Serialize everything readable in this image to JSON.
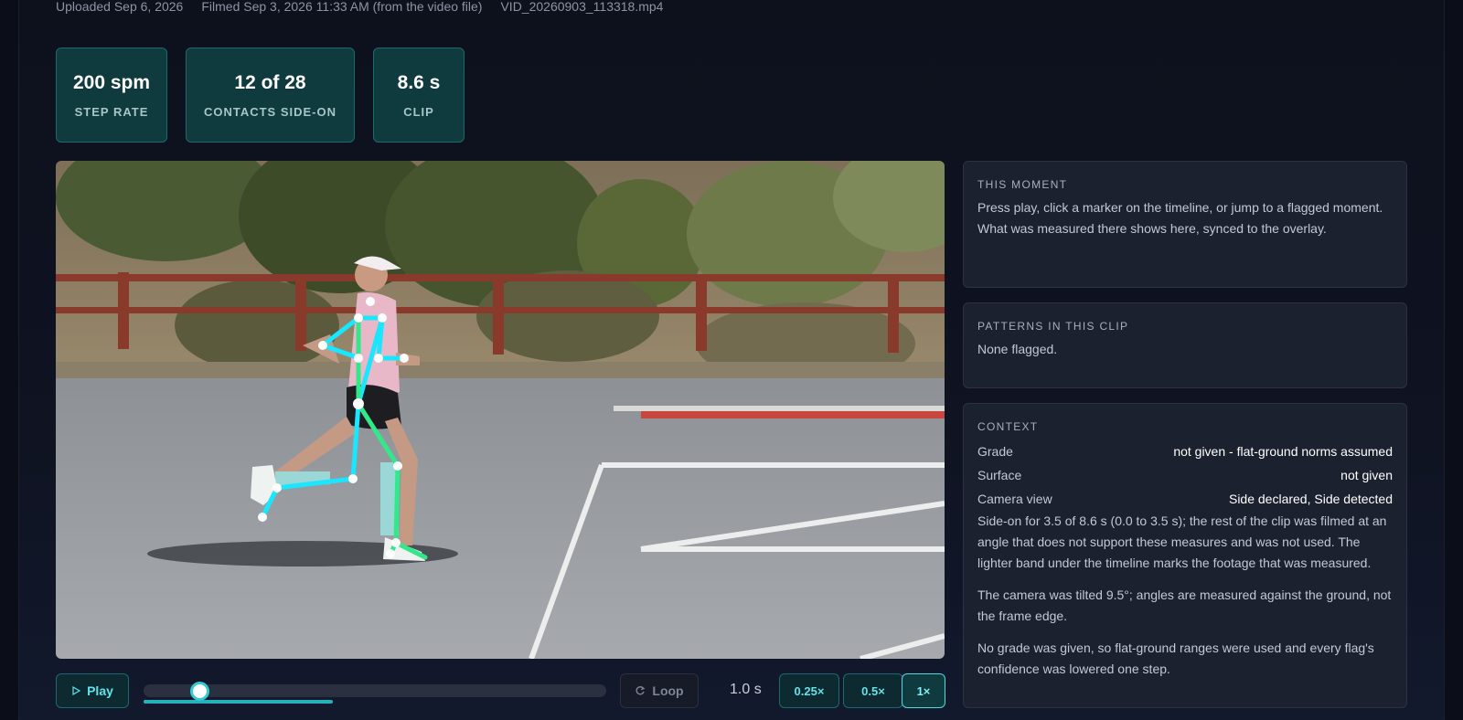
{
  "meta": {
    "uploaded": "Uploaded Sep 6, 2026",
    "filmed": "Filmed Sep 3, 2026 11:33 AM (from the video file)",
    "filename": "VID_20260903_113318.mp4"
  },
  "stats": [
    {
      "value": "200 spm",
      "label": "STEP RATE"
    },
    {
      "value": "12 of 28",
      "label": "CONTACTS SIDE-ON"
    },
    {
      "value": "8.6 s",
      "label": "CLIP"
    }
  ],
  "controls": {
    "play_label": "Play",
    "loop_label": "Loop",
    "time": "1.0 s",
    "speeds": [
      "0.25×",
      "0.5×",
      "1×"
    ],
    "active_speed": "1×",
    "playhead_fraction": 0.12,
    "measured_band_fraction": [
      0.0,
      0.41
    ]
  },
  "icons": {
    "play": "play-icon",
    "loop": "loop-icon"
  },
  "panels": {
    "moment": {
      "title": "THIS MOMENT",
      "text": "Press play, click a marker on the timeline, or jump to a flagged moment. What was measured there shows here, synced to the overlay."
    },
    "patterns": {
      "title": "PATTERNS IN THIS CLIP",
      "text": "None flagged."
    },
    "context": {
      "title": "CONTEXT",
      "rows": [
        {
          "key": "Grade",
          "value": "not given - flat-ground norms assumed"
        },
        {
          "key": "Surface",
          "value": "not given"
        },
        {
          "key": "Camera view",
          "value": "Side declared, Side detected"
        }
      ],
      "paragraphs": [
        "Side-on for 3.5 of 8.6 s (0.0 to 3.5 s); the rest of the clip was filmed at an angle that does not support these measures and was not used. The lighter band under the timeline marks the footage that was measured.",
        "The camera was tilted 9.5°; angles are measured against the ground, not the frame edge.",
        "No grade was given, so flat-ground ranges were used and every flag's confidence was lowered one step."
      ]
    }
  },
  "colors": {
    "accent": "#36c9d1",
    "stat_bg": "#0f3a3e",
    "skeleton_left": "#19e6ff",
    "skeleton_right": "#33e88a"
  }
}
